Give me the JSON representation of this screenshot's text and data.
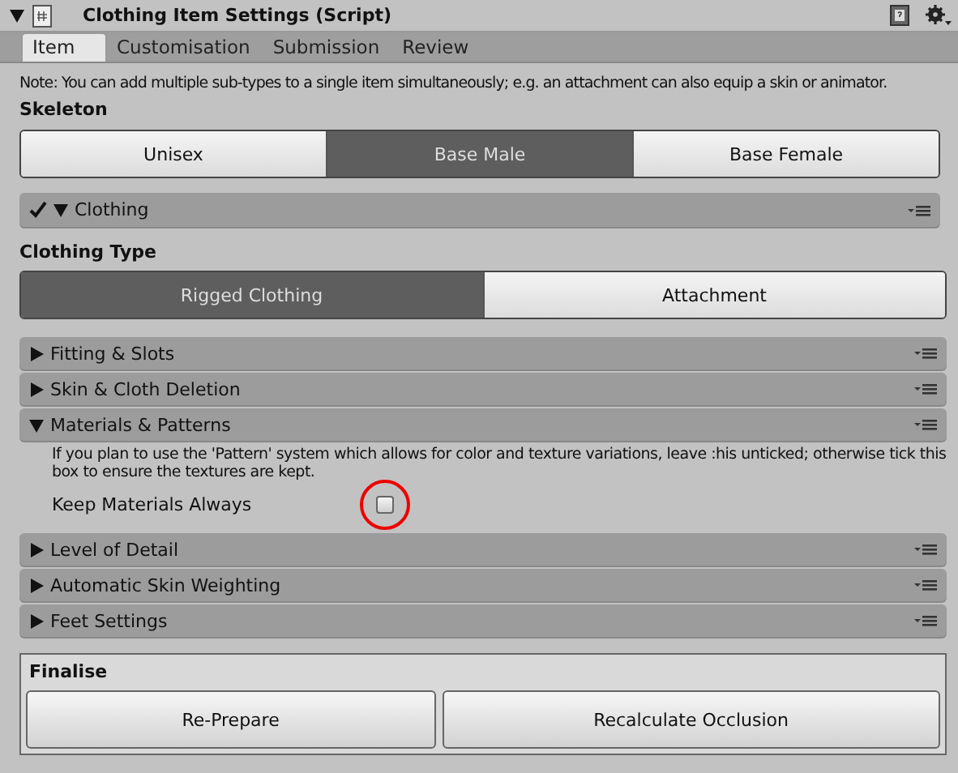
{
  "inspector": {
    "title": "Clothing Item Settings (Script)",
    "expanded": true
  },
  "tabs": [
    {
      "label": "Item",
      "selected": true
    },
    {
      "label": "Customisation",
      "selected": false
    },
    {
      "label": "Submission",
      "selected": false
    },
    {
      "label": "Review",
      "selected": false
    }
  ],
  "note": "Note: You can add multiple sub-types to a single item simultaneously; e.g. an attachment can also equip a skin or animator.",
  "skeleton": {
    "label": "Skeleton",
    "options": [
      {
        "label": "Unisex",
        "selected": false
      },
      {
        "label": "Base Male",
        "selected": true
      },
      {
        "label": "Base Female",
        "selected": false
      }
    ]
  },
  "clothing": {
    "label": "Clothing",
    "checked": true,
    "expanded": true,
    "type_label": "Clothing Type",
    "types": [
      {
        "label": "Rigged Clothing",
        "selected": true
      },
      {
        "label": "Attachment",
        "selected": false
      }
    ],
    "foldouts": [
      {
        "label": "Fitting & Slots",
        "expanded": false
      },
      {
        "label": "Skin & Cloth Deletion",
        "expanded": false
      },
      {
        "label": "Materials & Patterns",
        "expanded": true,
        "help": "If you plan to use the 'Pattern' system which allows for color and texture variations, leave :his unticked; otherwise tick this box to ensure the textures are kept.",
        "toggle": {
          "label": "Keep Materials Always",
          "checked": false,
          "highlighted": true
        }
      },
      {
        "label": "Level of Detail",
        "expanded": false
      },
      {
        "label": "Automatic Skin Weighting",
        "expanded": false
      },
      {
        "label": "Feet Settings",
        "expanded": false
      }
    ]
  },
  "finalise": {
    "label": "Finalise",
    "buttons": [
      "Re-Prepare",
      "Recalculate Occlusion"
    ]
  }
}
